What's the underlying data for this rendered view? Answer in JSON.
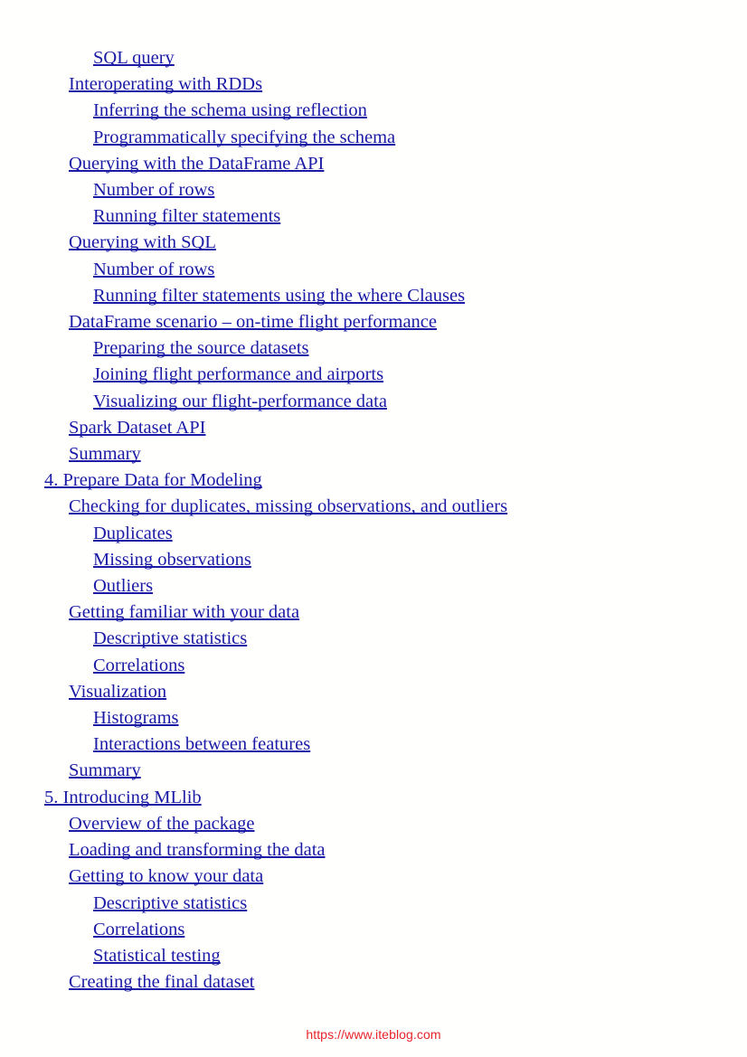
{
  "page": {
    "background_color": "#fffffd",
    "link_color": "#1a1aa6",
    "watermark_color": "#e8232a"
  },
  "toc": {
    "entries": [
      {
        "label": "SQL query",
        "level": 2
      },
      {
        "label": "Interoperating with RDDs",
        "level": 1
      },
      {
        "label": "Inferring the schema using reflection",
        "level": 2
      },
      {
        "label": "Programmatically specifying the schema",
        "level": 2
      },
      {
        "label": "Querying with the DataFrame API",
        "level": 1
      },
      {
        "label": "Number of rows",
        "level": 2
      },
      {
        "label": "Running filter statements",
        "level": 2
      },
      {
        "label": "Querying with SQL",
        "level": 1
      },
      {
        "label": "Number of rows",
        "level": 2
      },
      {
        "label": "Running filter statements using the where Clauses",
        "level": 2
      },
      {
        "label": "DataFrame scenario – on-time flight performance",
        "level": 1
      },
      {
        "label": "Preparing the source datasets",
        "level": 2
      },
      {
        "label": "Joining flight performance and airports",
        "level": 2
      },
      {
        "label": "Visualizing our flight-performance data",
        "level": 2
      },
      {
        "label": "Spark Dataset API",
        "level": 1
      },
      {
        "label": "Summary",
        "level": 1
      },
      {
        "label": "4. Prepare Data for Modeling",
        "level": 0
      },
      {
        "label": "Checking for duplicates, missing observations, and outliers",
        "level": 1
      },
      {
        "label": "Duplicates",
        "level": 2
      },
      {
        "label": "Missing observations",
        "level": 2
      },
      {
        "label": "Outliers",
        "level": 2
      },
      {
        "label": "Getting familiar with your data",
        "level": 1
      },
      {
        "label": "Descriptive statistics",
        "level": 2
      },
      {
        "label": "Correlations",
        "level": 2
      },
      {
        "label": "Visualization",
        "level": 1
      },
      {
        "label": "Histograms",
        "level": 2
      },
      {
        "label": "Interactions between features",
        "level": 2
      },
      {
        "label": "Summary",
        "level": 1
      },
      {
        "label": "5. Introducing MLlib",
        "level": 0
      },
      {
        "label": "Overview of the package",
        "level": 1
      },
      {
        "label": "Loading and transforming the data",
        "level": 1
      },
      {
        "label": "Getting to know your data",
        "level": 1
      },
      {
        "label": "Descriptive statistics",
        "level": 2
      },
      {
        "label": "Correlations",
        "level": 2
      },
      {
        "label": "Statistical testing",
        "level": 2
      },
      {
        "label": "Creating the final dataset",
        "level": 1
      }
    ]
  },
  "footer": {
    "watermark": "https://www.iteblog.com"
  }
}
